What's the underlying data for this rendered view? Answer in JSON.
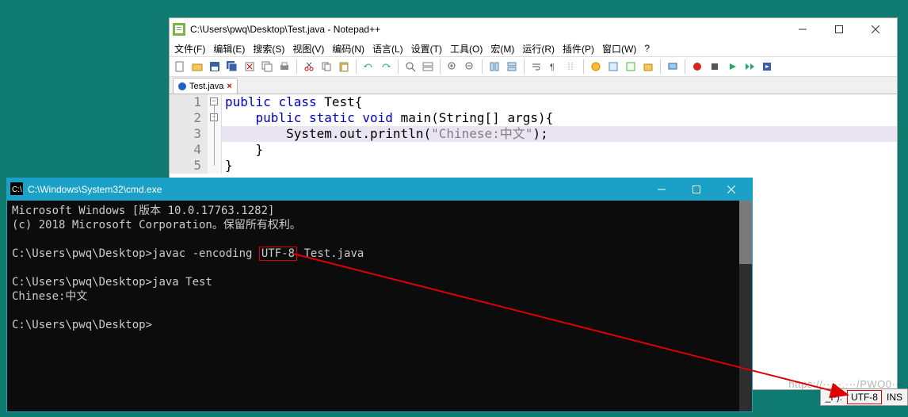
{
  "notepadpp": {
    "title": "C:\\Users\\pwq\\Desktop\\Test.java - Notepad++",
    "menu": [
      "文件(F)",
      "编辑(E)",
      "搜索(S)",
      "视图(V)",
      "编码(N)",
      "语言(L)",
      "设置(T)",
      "工具(O)",
      "宏(M)",
      "运行(R)",
      "插件(P)",
      "窗口(W)",
      "?"
    ],
    "tab": {
      "label": "Test.java"
    },
    "gutters": [
      "1",
      "2",
      "3",
      "4",
      "5"
    ],
    "code": {
      "l1": {
        "kw1": "public",
        "kw2": "class",
        "name": "Test",
        "brace": "{"
      },
      "l2": {
        "indent": "    ",
        "kw1": "public",
        "kw2": "static",
        "kw3": "void",
        "name": "main",
        "sig": "(String[] args){"
      },
      "l3": {
        "indent": "        ",
        "call": "System.out.println(",
        "str": "\"Chinese:中文\"",
        "end": ");"
      },
      "l4": {
        "indent": "    ",
        "brace": "}"
      },
      "l5": {
        "brace": "}"
      }
    }
  },
  "cmd": {
    "title": "C:\\Windows\\System32\\cmd.exe",
    "lines": {
      "l1": "Microsoft Windows [版本 10.0.17763.1282]",
      "l2": "(c) 2018 Microsoft Corporation。保留所有权利。",
      "l3_prompt": "C:\\Users\\pwq\\Desktop>",
      "l3_cmd_a": "javac -encoding ",
      "l3_box": "UTF-8",
      "l3_cmd_b": " Test.java",
      "l5_prompt": "C:\\Users\\pwq\\Desktop>",
      "l5_cmd": "java Test",
      "l6": "Chinese:中文",
      "l8_prompt": "C:\\Users\\pwq\\Desktop>"
    }
  },
  "status": {
    "left": "_F):",
    "utf8": "UTF-8",
    "right": "INS"
  },
  "watermark": "https://·····.···/PWO0···",
  "colors": {
    "desktop": "#0f7a6f",
    "cmd_title": "#1ba1c7",
    "annotation": "#d00"
  }
}
